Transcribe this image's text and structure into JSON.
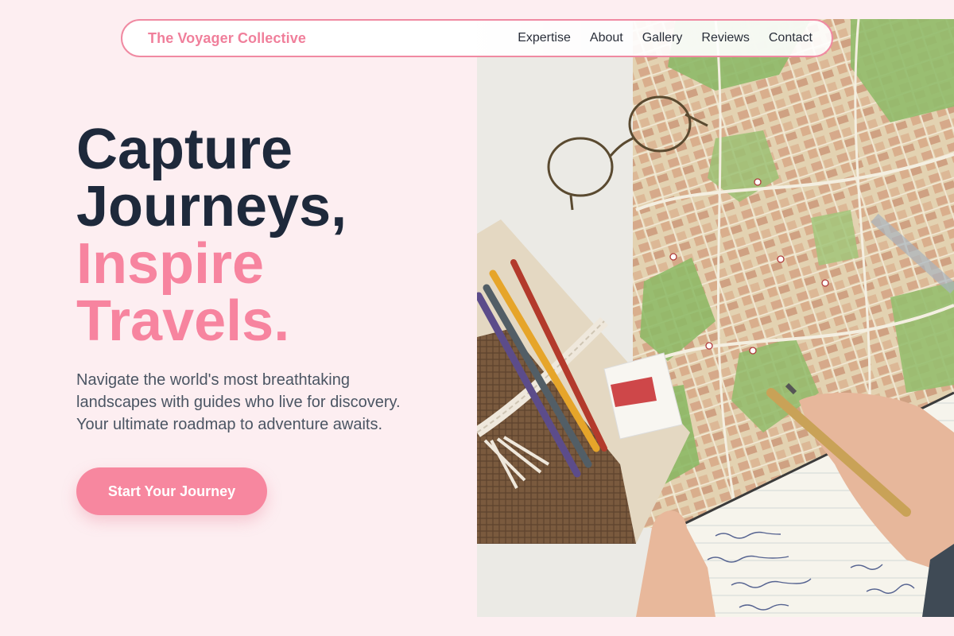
{
  "nav": {
    "brand": "The Voyager Collective",
    "links": [
      "Expertise",
      "About",
      "Gallery",
      "Reviews",
      "Contact"
    ]
  },
  "hero": {
    "title_line1": "Capture",
    "title_line2": "Journeys,",
    "title_line3": "Inspire",
    "title_line4": "Travels.",
    "description": "Navigate the world's most breathtaking landscapes with guides who live for discovery. Your ultimate roadmap to adventure awaits.",
    "cta_label": "Start Your Journey"
  },
  "colors": {
    "background": "#fdeef1",
    "accent": "#f7849f",
    "heading": "#1e293b",
    "body_text": "#4b5563"
  },
  "image": {
    "subject": "map-desk-photo"
  }
}
